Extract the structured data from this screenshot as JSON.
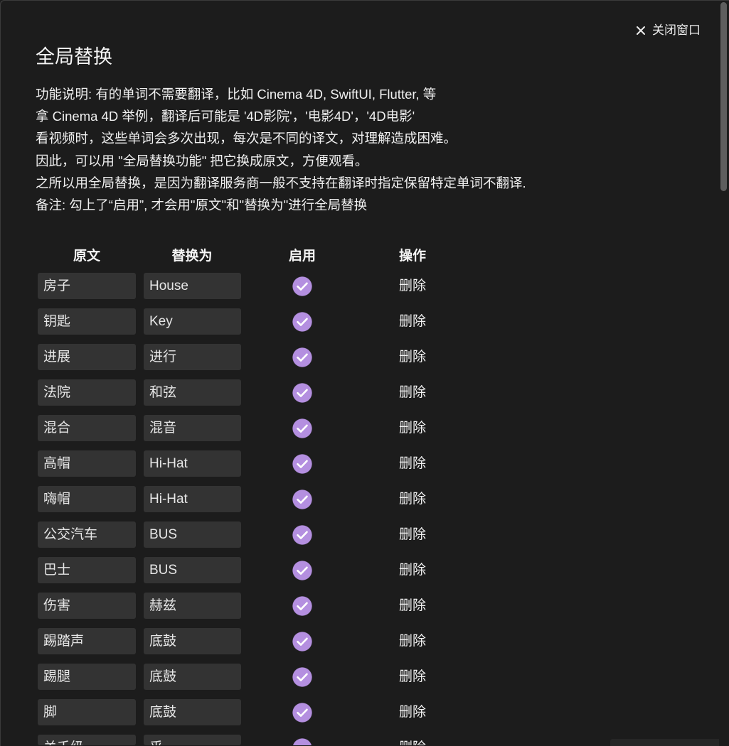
{
  "window": {
    "close_label": "关闭窗口",
    "close_icon": "close-icon"
  },
  "title": "全局替换",
  "description": [
    "功能说明: 有的单词不需要翻译，比如 Cinema 4D, SwiftUI, Flutter, 等",
    "拿 Cinema 4D 举例，翻译后可能是 '4D影院'，'电影4D'，'4D电影'",
    "看视频时，这些单词会多次出现，每次是不同的译文，对理解造成困难。",
    "因此，可以用 \"全局替换功能\" 把它换成原文，方便观看。",
    "之所以用全局替换，是因为翻译服务商一般不支持在翻译时指定保留特定单词不翻译.",
    "备注: 勾上了“启用”, 才会用\"原文\"和\"替换为\"进行全局替换"
  ],
  "table": {
    "headers": {
      "original": "原文",
      "replacement": "替换为",
      "enabled": "启用",
      "actions": "操作"
    },
    "delete_label": "删除",
    "rows": [
      {
        "original": "房子",
        "replacement": "House",
        "enabled": true
      },
      {
        "original": "钥匙",
        "replacement": "Key",
        "enabled": true
      },
      {
        "original": "进展",
        "replacement": "进行",
        "enabled": true
      },
      {
        "original": "法院",
        "replacement": "和弦",
        "enabled": true
      },
      {
        "original": "混合",
        "replacement": "混音",
        "enabled": true
      },
      {
        "original": "高帽",
        "replacement": "Hi-Hat",
        "enabled": true
      },
      {
        "original": "嗨帽",
        "replacement": "Hi-Hat",
        "enabled": true
      },
      {
        "original": "公交汽车",
        "replacement": "BUS",
        "enabled": true
      },
      {
        "original": "巴士",
        "replacement": "BUS",
        "enabled": true
      },
      {
        "original": "伤害",
        "replacement": "赫兹",
        "enabled": true
      },
      {
        "original": "踢踏声",
        "replacement": "底鼓",
        "enabled": true
      },
      {
        "original": "踢腿",
        "replacement": "底鼓",
        "enabled": true
      },
      {
        "original": "脚",
        "replacement": "底鼓",
        "enabled": true
      },
      {
        "original": "关千级",
        "replacement": "乎",
        "enabled": true
      }
    ]
  },
  "colors": {
    "background": "#1c1c1c",
    "field_background": "#333333",
    "accent": "#b48fe0",
    "text": "#f0f0f0"
  }
}
